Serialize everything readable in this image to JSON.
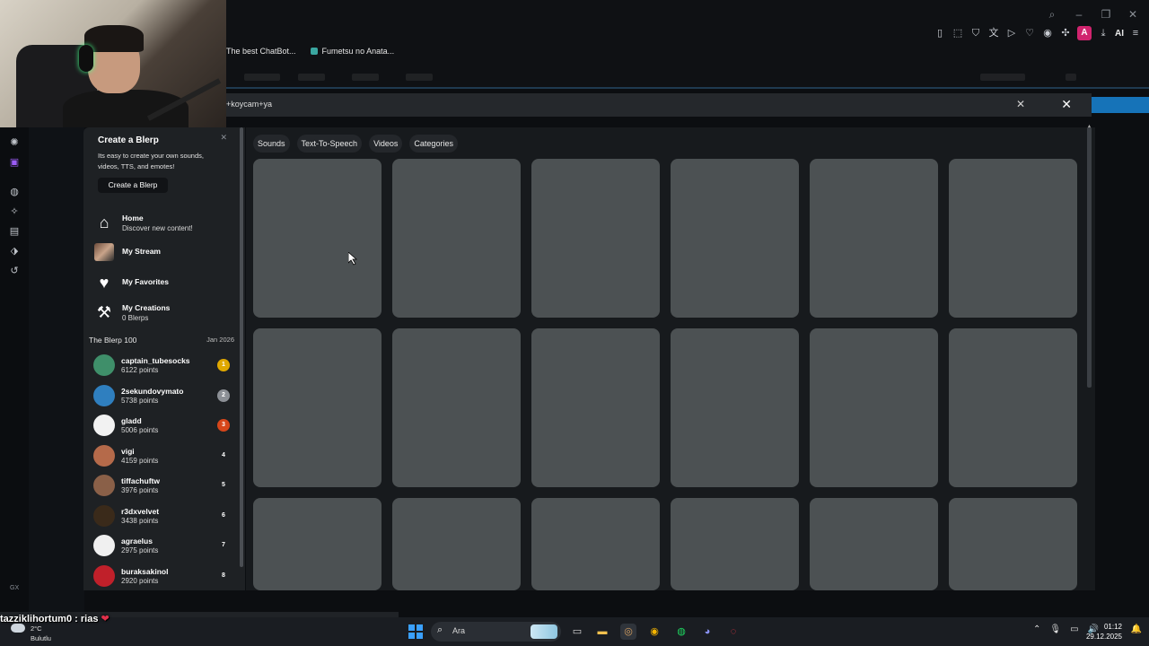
{
  "browser": {
    "bookmarks": [
      {
        "label": "The best ChatBot..."
      },
      {
        "label": "Fumetsu no Anata..."
      }
    ],
    "toolbar_icons": [
      "bookmark-icon",
      "snapshot-icon",
      "shield-icon",
      "translate-icon",
      "play-icon",
      "heart-icon",
      "extension-icon",
      "puzzle-icon"
    ],
    "avatar_letter": "A",
    "ai_label": "AI"
  },
  "search": {
    "query": "+koycam+ya"
  },
  "tabs": [
    {
      "label": "Sounds"
    },
    {
      "label": "Text-To-Speech"
    },
    {
      "label": "Videos"
    },
    {
      "label": "Categories"
    }
  ],
  "blerp": {
    "create_title": "Create a Blerp",
    "create_desc": "Its easy to create your own sounds, videos, TTS, and emotes!",
    "create_button": "Create a Blerp",
    "nav": [
      {
        "label": "Home",
        "sub": "Discover new content!",
        "icon": "home-icon"
      },
      {
        "label": "My Stream",
        "sub": "",
        "icon": "stream-icon"
      },
      {
        "label": "My Favorites",
        "sub": "",
        "icon": "heart-icon"
      },
      {
        "label": "My Creations",
        "sub": "0 Blerps",
        "icon": "hammer-icon"
      }
    ],
    "leaderboard_title": "The Blerp 100",
    "leaderboard_date": "Jan 2026",
    "leaderboard": [
      {
        "name": "captain_tubesocks",
        "points": "6122 points",
        "rank": "1",
        "rank_color": "#e0a800",
        "avatar_color": "#3f8f6a"
      },
      {
        "name": "2sekundovymato",
        "points": "5738 points",
        "rank": "2",
        "rank_color": "#8c9096",
        "avatar_color": "#2f7fbf"
      },
      {
        "name": "gladd",
        "points": "5006 points",
        "rank": "3",
        "rank_color": "#d6461a",
        "avatar_color": "#f2f2f2"
      },
      {
        "name": "vigi",
        "points": "4159 points",
        "rank": "4",
        "rank_color": "transparent",
        "avatar_color": "#b56a4a"
      },
      {
        "name": "tiffachuftw",
        "points": "3976 points",
        "rank": "5",
        "rank_color": "transparent",
        "avatar_color": "#8a6048"
      },
      {
        "name": "r3dxvelvet",
        "points": "3438 points",
        "rank": "6",
        "rank_color": "transparent",
        "avatar_color": "#3a2a1a"
      },
      {
        "name": "agraelus",
        "points": "2975 points",
        "rank": "7",
        "rank_color": "transparent",
        "avatar_color": "#f0f0f0"
      },
      {
        "name": "buraksakinol",
        "points": "2920 points",
        "rank": "8",
        "rank_color": "transparent",
        "avatar_color": "#c0202a"
      }
    ]
  },
  "chat_overlay": {
    "user": "tazziklihortum0",
    "message": ": rias",
    "heart": "❤"
  },
  "taskbar": {
    "weather_temp": "2°C",
    "weather_cond": "Bulutlu",
    "search_placeholder": "Ara",
    "time": "01:12",
    "date": "29.12.2025",
    "gx_label": "GX"
  }
}
